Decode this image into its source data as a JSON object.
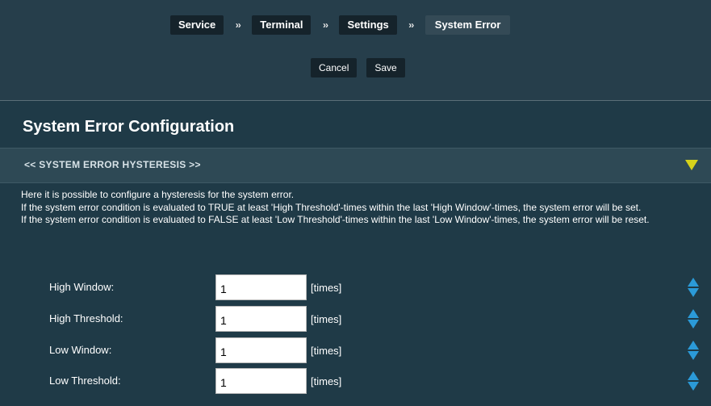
{
  "breadcrumb": {
    "items": [
      "Service",
      "Terminal",
      "Settings",
      "System Error"
    ],
    "separator": "››"
  },
  "actions": {
    "cancel_label": "Cancel",
    "save_label": "Save"
  },
  "page_title": "System Error Configuration",
  "section": {
    "label": "<<  SYSTEM ERROR HYSTERESIS  >>"
  },
  "description": {
    "lines": [
      "Here it is possible to configure a hysteresis for the system error.",
      "If the system error condition is evaluated to TRUE at least 'High Threshold'-times within the last 'High Window'-times, the system error will be set.",
      "If the system error condition is evaluated to FALSE at least 'Low Threshold'-times within the last 'Low Window'-times, the system error will be reset."
    ]
  },
  "fields": [
    {
      "label": "High Window:",
      "value": "1",
      "unit": "[times]"
    },
    {
      "label": "High Threshold:",
      "value": "1",
      "unit": "[times]"
    },
    {
      "label": "Low Window:",
      "value": "1",
      "unit": "[times]"
    },
    {
      "label": "Low Threshold:",
      "value": "1",
      "unit": "[times]"
    }
  ],
  "icons": {
    "section_toggle": "triangle-down-icon",
    "spinner": "spinner-updown-icon"
  },
  "colors": {
    "background": "#1f3a47",
    "header": "#263e4b",
    "button": "#15232b",
    "section_bar": "#2e4955",
    "toggle_arrow": "#d6d21a",
    "spinner": "#2b9ad8"
  }
}
